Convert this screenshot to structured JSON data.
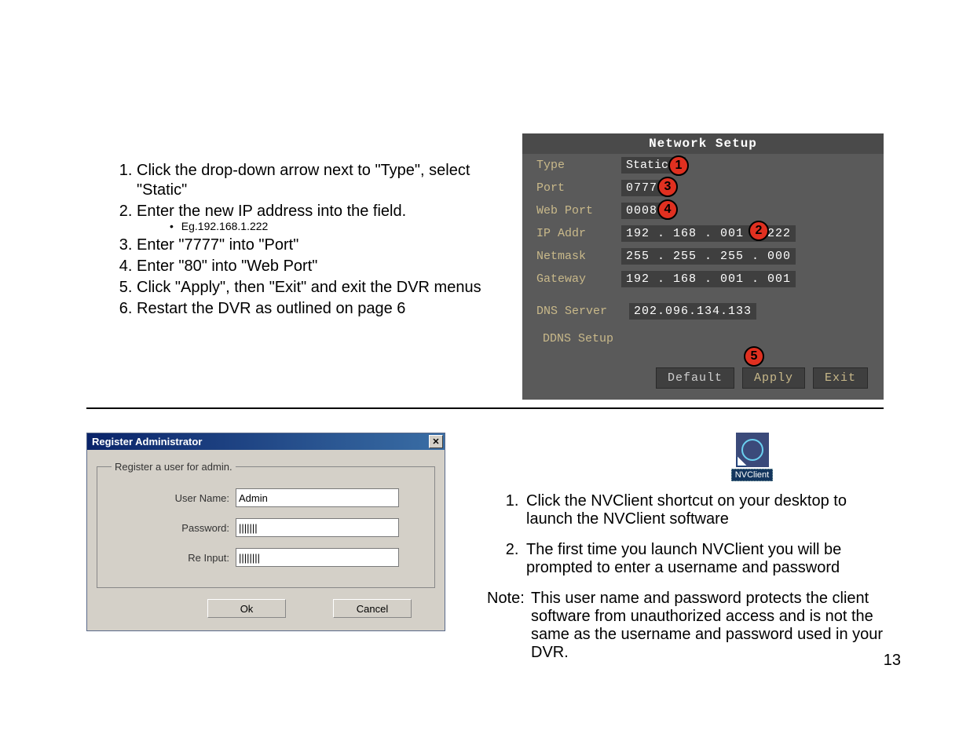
{
  "left_instructions": {
    "items": [
      "Click the drop-down arrow next to \"Type\", select \"Static\"",
      "Enter the new IP address into the field.",
      "Enter \"7777\" into \"Port\"",
      "Enter \"80\" into \"Web Port\"",
      "Click \"Apply\", then \"Exit\" and exit the DVR menus",
      "Restart the DVR as outlined on page 6"
    ],
    "sub_bullet": "Eg.192.168.1.222"
  },
  "network_setup": {
    "title": "Network Setup",
    "labels": {
      "type": "Type",
      "port": "Port",
      "web_port": "Web Port",
      "ip_addr": "IP Addr",
      "netmask": "Netmask",
      "gateway": "Gateway",
      "dns_server": "DNS Server",
      "ddns": "DDNS Setup"
    },
    "values": {
      "type": "Static",
      "port": "07777",
      "web_port": "00080",
      "ip_addr": "192 . 168 . 001 . 222",
      "netmask": "255 . 255 . 255 . 000",
      "gateway": "192 . 168 . 001 . 001",
      "dns_server": "202.096.134.133"
    },
    "buttons": {
      "default": "Default",
      "apply": "Apply",
      "exit": "Exit"
    },
    "callouts": [
      "1",
      "2",
      "3",
      "4",
      "5"
    ]
  },
  "register_dialog": {
    "title": "Register Administrator",
    "legend": "Register  a user for admin.",
    "labels": {
      "username": "User Name:",
      "password": "Password:",
      "reinput": "Re Input:"
    },
    "values": {
      "username": "Admin",
      "password": "|||||||",
      "reinput": "||||||||"
    },
    "buttons": {
      "ok": "Ok",
      "cancel": "Cancel"
    }
  },
  "nvclient": {
    "label": "NVClient"
  },
  "right_instructions": {
    "items": [
      "Click the NVClient shortcut on your desktop to launch the NVClient software",
      "The first time you launch NVClient you will be prompted to enter a username and password"
    ],
    "note_lead": "Note:",
    "note": "This user name and password protects the client software from unauthorized access and is not the same as the username and password used in your DVR."
  },
  "page_number": "13"
}
